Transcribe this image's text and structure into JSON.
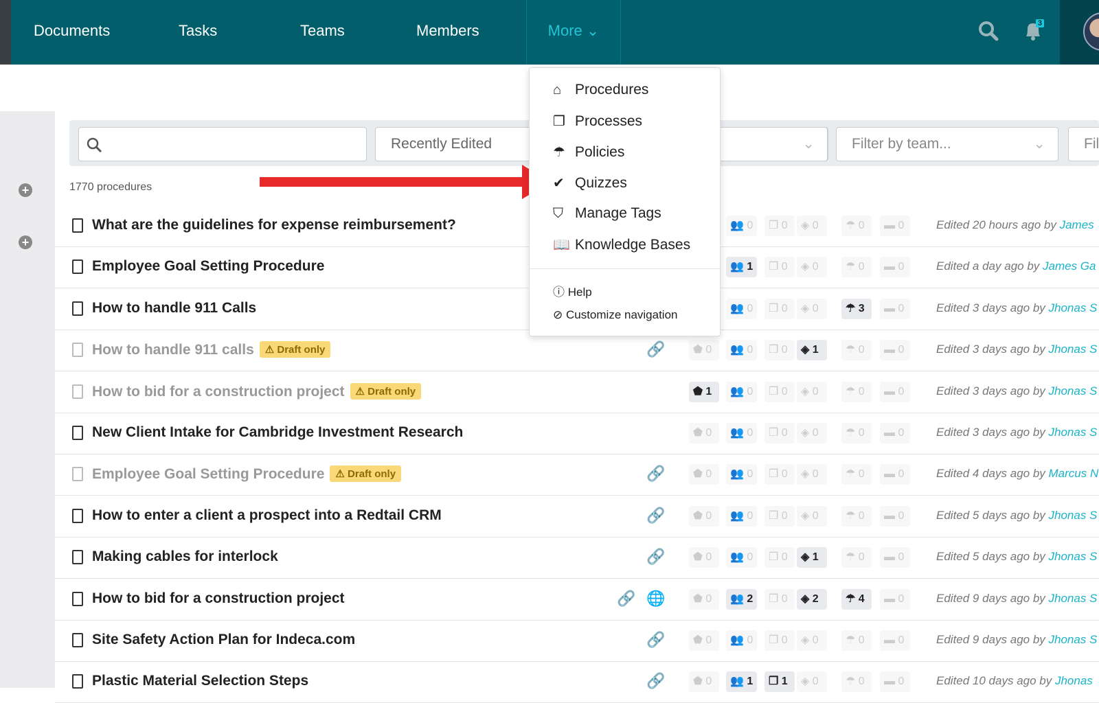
{
  "nav": {
    "items": [
      "Documents",
      "Tasks",
      "Teams",
      "Members"
    ],
    "more": "More ⌄",
    "notification_count": "3"
  },
  "filters": {
    "search_placeholder": "",
    "sort": "Recently Edited",
    "team_placeholder": "Filter by team...",
    "extra_placeholder": "Filt"
  },
  "count": "1770 procedures",
  "draft_label": "Draft only",
  "menu": {
    "items": [
      {
        "icon": "home-icon",
        "glyph": "⌂",
        "label": "Procedures"
      },
      {
        "icon": "processes-icon",
        "glyph": "❐",
        "label": "Processes"
      },
      {
        "icon": "umbrella-icon",
        "glyph": "☂",
        "label": "Policies"
      },
      {
        "icon": "check-icon",
        "glyph": "✔",
        "label": "Quizzes"
      },
      {
        "icon": "tags-icon",
        "glyph": "⛉",
        "label": "Manage Tags"
      },
      {
        "icon": "book-icon",
        "glyph": "📖",
        "label": "Knowledge Bases"
      }
    ],
    "help": "Help",
    "customize": "Customize navigation"
  },
  "colors": {
    "header": "#035e6b",
    "accent": "#1bb3c9",
    "draft": "#f9d878",
    "arrow": "#e8292a"
  },
  "rows": [
    {
      "title": "What are the guidelines for expense reimbursement?",
      "draft": false,
      "link": false,
      "globe": false,
      "stats": [
        null,
        0,
        0,
        0,
        0,
        0
      ],
      "edited": "Edited 20 hours ago by",
      "by": "James"
    },
    {
      "title": "Employee Goal Setting Procedure",
      "draft": false,
      "link": false,
      "globe": false,
      "stats": [
        null,
        1,
        0,
        0,
        0,
        0
      ],
      "edited": "Edited a day ago by",
      "by": "James Ga"
    },
    {
      "title": "How to handle 911 Calls",
      "draft": false,
      "link": false,
      "globe": false,
      "stats": [
        null,
        0,
        0,
        0,
        3,
        0
      ],
      "edited": "Edited 3 days ago by",
      "by": "Jhonas S"
    },
    {
      "title": "How to handle 911 calls",
      "draft": true,
      "link": true,
      "globe": false,
      "stats": [
        0,
        0,
        0,
        1,
        0,
        0
      ],
      "edited": "Edited 3 days ago by",
      "by": "Jhonas S"
    },
    {
      "title": "How to bid for a construction project",
      "draft": true,
      "link": false,
      "globe": false,
      "stats": [
        1,
        0,
        0,
        0,
        0,
        0
      ],
      "edited": "Edited 3 days ago by",
      "by": "Jhonas S"
    },
    {
      "title": "New Client Intake for Cambridge Investment Research",
      "draft": false,
      "link": false,
      "globe": false,
      "stats": [
        0,
        0,
        0,
        0,
        0,
        0
      ],
      "edited": "Edited 3 days ago by",
      "by": "Jhonas S"
    },
    {
      "title": "Employee Goal Setting Procedure",
      "draft": true,
      "link": true,
      "globe": false,
      "stats": [
        0,
        0,
        0,
        0,
        0,
        0
      ],
      "edited": "Edited 4 days ago by",
      "by": "Marcus N"
    },
    {
      "title": "How to enter a client a prospect into a Redtail CRM",
      "draft": false,
      "link": true,
      "globe": false,
      "stats": [
        0,
        0,
        0,
        0,
        0,
        0
      ],
      "edited": "Edited 5 days ago by",
      "by": "Jhonas S"
    },
    {
      "title": "Making cables for interlock",
      "draft": false,
      "link": true,
      "globe": false,
      "stats": [
        0,
        0,
        0,
        1,
        0,
        0
      ],
      "edited": "Edited 5 days ago by",
      "by": "Jhonas S"
    },
    {
      "title": "How to bid for a construction project",
      "draft": false,
      "link": true,
      "globe": true,
      "stats": [
        0,
        2,
        0,
        2,
        4,
        0
      ],
      "edited": "Edited 9 days ago by",
      "by": "Jhonas S"
    },
    {
      "title": "Site Safety Action Plan for Indeca.com",
      "draft": false,
      "link": true,
      "globe": false,
      "stats": [
        0,
        0,
        0,
        0,
        0,
        0
      ],
      "edited": "Edited 9 days ago by",
      "by": "Jhonas S"
    },
    {
      "title": "Plastic Material Selection Steps",
      "draft": false,
      "link": true,
      "globe": false,
      "stats": [
        0,
        1,
        1,
        0,
        0,
        0
      ],
      "edited": "Edited 10 days ago by",
      "by": "Jhonas"
    }
  ]
}
